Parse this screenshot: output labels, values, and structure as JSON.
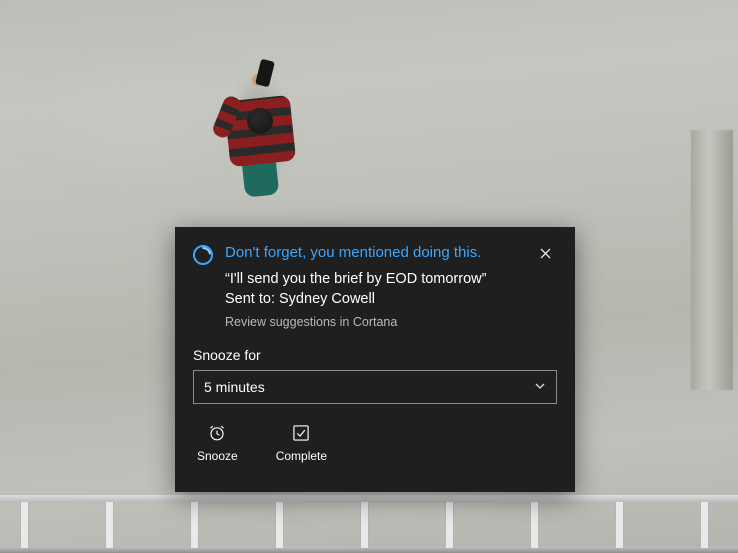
{
  "toast": {
    "title": "Don't forget, you mentioned doing this.",
    "quote": "“I'll send you the brief by EOD tomorrow”",
    "sent_to_prefix": "Sent to: ",
    "sent_to_name": "Sydney Cowell",
    "review_line": "Review suggestions in Cortana",
    "snooze_label": "Snooze for",
    "snooze_selected": "5 minutes",
    "actions": {
      "snooze": "Snooze",
      "complete": "Complete"
    }
  },
  "colors": {
    "accent": "#3aa7ff",
    "toast_bg": "#1f1f1f"
  }
}
